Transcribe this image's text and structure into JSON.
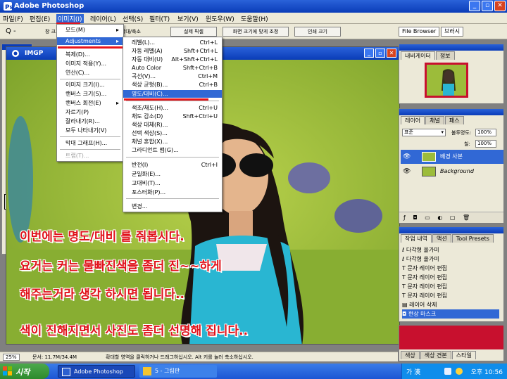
{
  "app": {
    "title": "Adobe Photoshop"
  },
  "menubar": {
    "items": [
      {
        "label": "파일(F)"
      },
      {
        "label": "편집(E)"
      },
      {
        "label": "이미지(I)"
      },
      {
        "label": "레이어(L)"
      },
      {
        "label": "선택(S)"
      },
      {
        "label": "필터(T)"
      },
      {
        "label": "보기(V)"
      },
      {
        "label": "윈도우(W)"
      },
      {
        "label": "도움말(H)"
      }
    ],
    "active_index": 2
  },
  "options_bar": {
    "zoom_indicator": "Q -",
    "checkbox_labels": [
      "창 크기 조절",
      "모든 창 확대/축소"
    ],
    "buttons": [
      "실제 픽셀",
      "화면 크기에 맞게 조정",
      "인쇄 크기"
    ],
    "wells": [
      "File Browser",
      "브러시"
    ]
  },
  "document": {
    "title": "IMGP",
    "zoom": "25%",
    "doc_size": "문서: 11.7M/34.4M"
  },
  "image_menu": {
    "items": [
      {
        "label": "모드(M)",
        "submenu": true
      },
      {
        "label": "Adjustments",
        "submenu": true,
        "highlight": true
      },
      {
        "sep": true
      },
      {
        "label": "복제(D)..."
      },
      {
        "label": "이미지 적용(Y)..."
      },
      {
        "label": "연산(C)..."
      },
      {
        "sep": true
      },
      {
        "label": "이미지 크기(I)..."
      },
      {
        "label": "캔버스 크기(S)..."
      },
      {
        "label": "캔버스 회전(E)",
        "submenu": true
      },
      {
        "label": "자르기(P)"
      },
      {
        "label": "잘라내기(R)..."
      },
      {
        "label": "모두 나타내기(V)"
      },
      {
        "sep": true
      },
      {
        "label": "막대 그래프(H)..."
      },
      {
        "sep": true
      },
      {
        "label": "트랩(T)...",
        "disabled": true
      }
    ]
  },
  "adjust_menu": {
    "items": [
      {
        "label": "레벨(L)...",
        "shortcut": "Ctrl+L"
      },
      {
        "label": "자동 레벨(A)",
        "shortcut": "Shft+Ctrl+L"
      },
      {
        "label": "자동 대비(U)",
        "shortcut": "Alt+Shft+Ctrl+L"
      },
      {
        "label": "Auto Color",
        "shortcut": "Shft+Ctrl+B"
      },
      {
        "label": "곡선(V)...",
        "shortcut": "Ctrl+M"
      },
      {
        "label": "색상 균형(B)...",
        "shortcut": "Ctrl+B"
      },
      {
        "label": "명도/대비(C)...",
        "shortcut": "",
        "highlight": true
      },
      {
        "sep": true
      },
      {
        "label": "색조/채도(H)...",
        "shortcut": "Ctrl+U"
      },
      {
        "label": "채도 감소(D)",
        "shortcut": "Shft+Ctrl+U"
      },
      {
        "label": "색상 대체(R)...",
        "shortcut": ""
      },
      {
        "label": "선택 색상(S)...",
        "shortcut": ""
      },
      {
        "label": "채널 혼합(X)...",
        "shortcut": ""
      },
      {
        "label": "그라디언트 맵(G)...",
        "shortcut": ""
      },
      {
        "sep": true
      },
      {
        "label": "반전(I)",
        "shortcut": "Ctrl+I"
      },
      {
        "label": "균일화(E)...",
        "shortcut": ""
      },
      {
        "label": "고대비(T)...",
        "shortcut": ""
      },
      {
        "label": "포스터화(P)...",
        "shortcut": ""
      },
      {
        "sep": true
      },
      {
        "label": "변경...",
        "shortcut": ""
      }
    ]
  },
  "captions": [
    "이번에는 명도/대비 를 줘봅시다.",
    "요거는 커는 물빠진색을 좀더 진~~하게",
    "해주는거라 생각 하시면 됩니다..",
    "색이 진해지면서 사진도 좀더 선명해 집니다.."
  ],
  "navigator_panel": {
    "tabs": [
      "내비게이터",
      "정보"
    ]
  },
  "layers_panel": {
    "tabs": [
      "레이어",
      "채널",
      "패스"
    ],
    "blend_mode": "표준",
    "opacity_label": "불투명도:",
    "opacity": "100%",
    "fill_label": "칠:",
    "fill": "100%",
    "layers": [
      {
        "name": "배경 사본",
        "selected": true
      },
      {
        "name": "Background",
        "selected": false
      }
    ]
  },
  "history_panel": {
    "tabs": [
      "작업 내역",
      "액션",
      "Tool Presets"
    ],
    "items": [
      {
        "label": "다각형 올가미",
        "icon": "polygon-lasso-icon"
      },
      {
        "label": "다각형 올가미",
        "icon": "polygon-lasso-icon"
      },
      {
        "label": "문자 레이어 편집",
        "icon": "type-icon"
      },
      {
        "label": "문자 레이어 편집",
        "icon": "type-icon"
      },
      {
        "label": "문자 레이어 편집",
        "icon": "type-icon"
      },
      {
        "label": "문자 레이어 편집",
        "icon": "type-icon"
      },
      {
        "label": "레이어 삭제",
        "icon": "delete-layer-icon"
      },
      {
        "label": "현상 마스크",
        "icon": "mask-icon",
        "selected": true
      }
    ]
  },
  "swatches_panel": {
    "tabs": [
      "색상",
      "색상 견본",
      "스타일"
    ]
  },
  "status_hint": "확대할 영역을 클릭하거나 드래그하십시오. Alt 키를 눌러 축소하십시오.",
  "taskbar": {
    "start_label": "시작",
    "tasks": [
      {
        "label": "Adobe Photoshop",
        "active": true
      },
      {
        "label": "5 - 그림판",
        "active": false
      }
    ],
    "ime": "가 漢",
    "clock": "오후 10:56"
  },
  "colors": {
    "title_blue": "#0a3cb8",
    "highlight": "#3168d5",
    "annotation_red": "#e8141a",
    "caption_red": "#e0121a",
    "ui_gray": "#ece9d8"
  }
}
